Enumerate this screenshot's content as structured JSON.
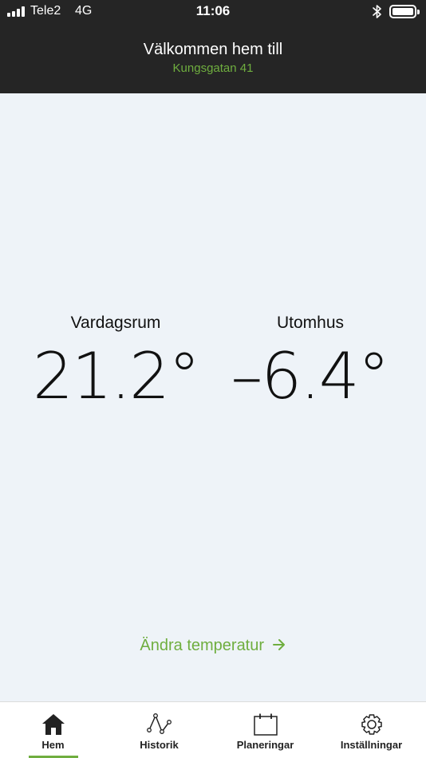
{
  "status_bar": {
    "carrier": "Tele2",
    "network": "4G",
    "time": "11:06",
    "icons": [
      "signal-icon",
      "bluetooth-icon",
      "battery-icon"
    ]
  },
  "header": {
    "title": "Välkommen hem till",
    "address": "Kungsgatan 41"
  },
  "rooms": [
    {
      "name": "Vardagsrum",
      "temperature": "21.2°"
    },
    {
      "name": "Utomhus",
      "temperature": "–6.4°"
    }
  ],
  "change_temperature": {
    "label": "Ändra temperatur",
    "icon": "arrow-right-icon"
  },
  "tabbar": {
    "active": "Hem",
    "items": [
      {
        "label": "Hem",
        "icon": "home-icon"
      },
      {
        "label": "Historik",
        "icon": "history-icon"
      },
      {
        "label": "Planeringar",
        "icon": "calendar-icon"
      },
      {
        "label": "Inställningar",
        "icon": "gear-icon"
      }
    ]
  },
  "colors": {
    "header_bg": "#252525",
    "accent": "#6fae3f",
    "content_bg": "#eef3f8",
    "text": "#111111"
  }
}
